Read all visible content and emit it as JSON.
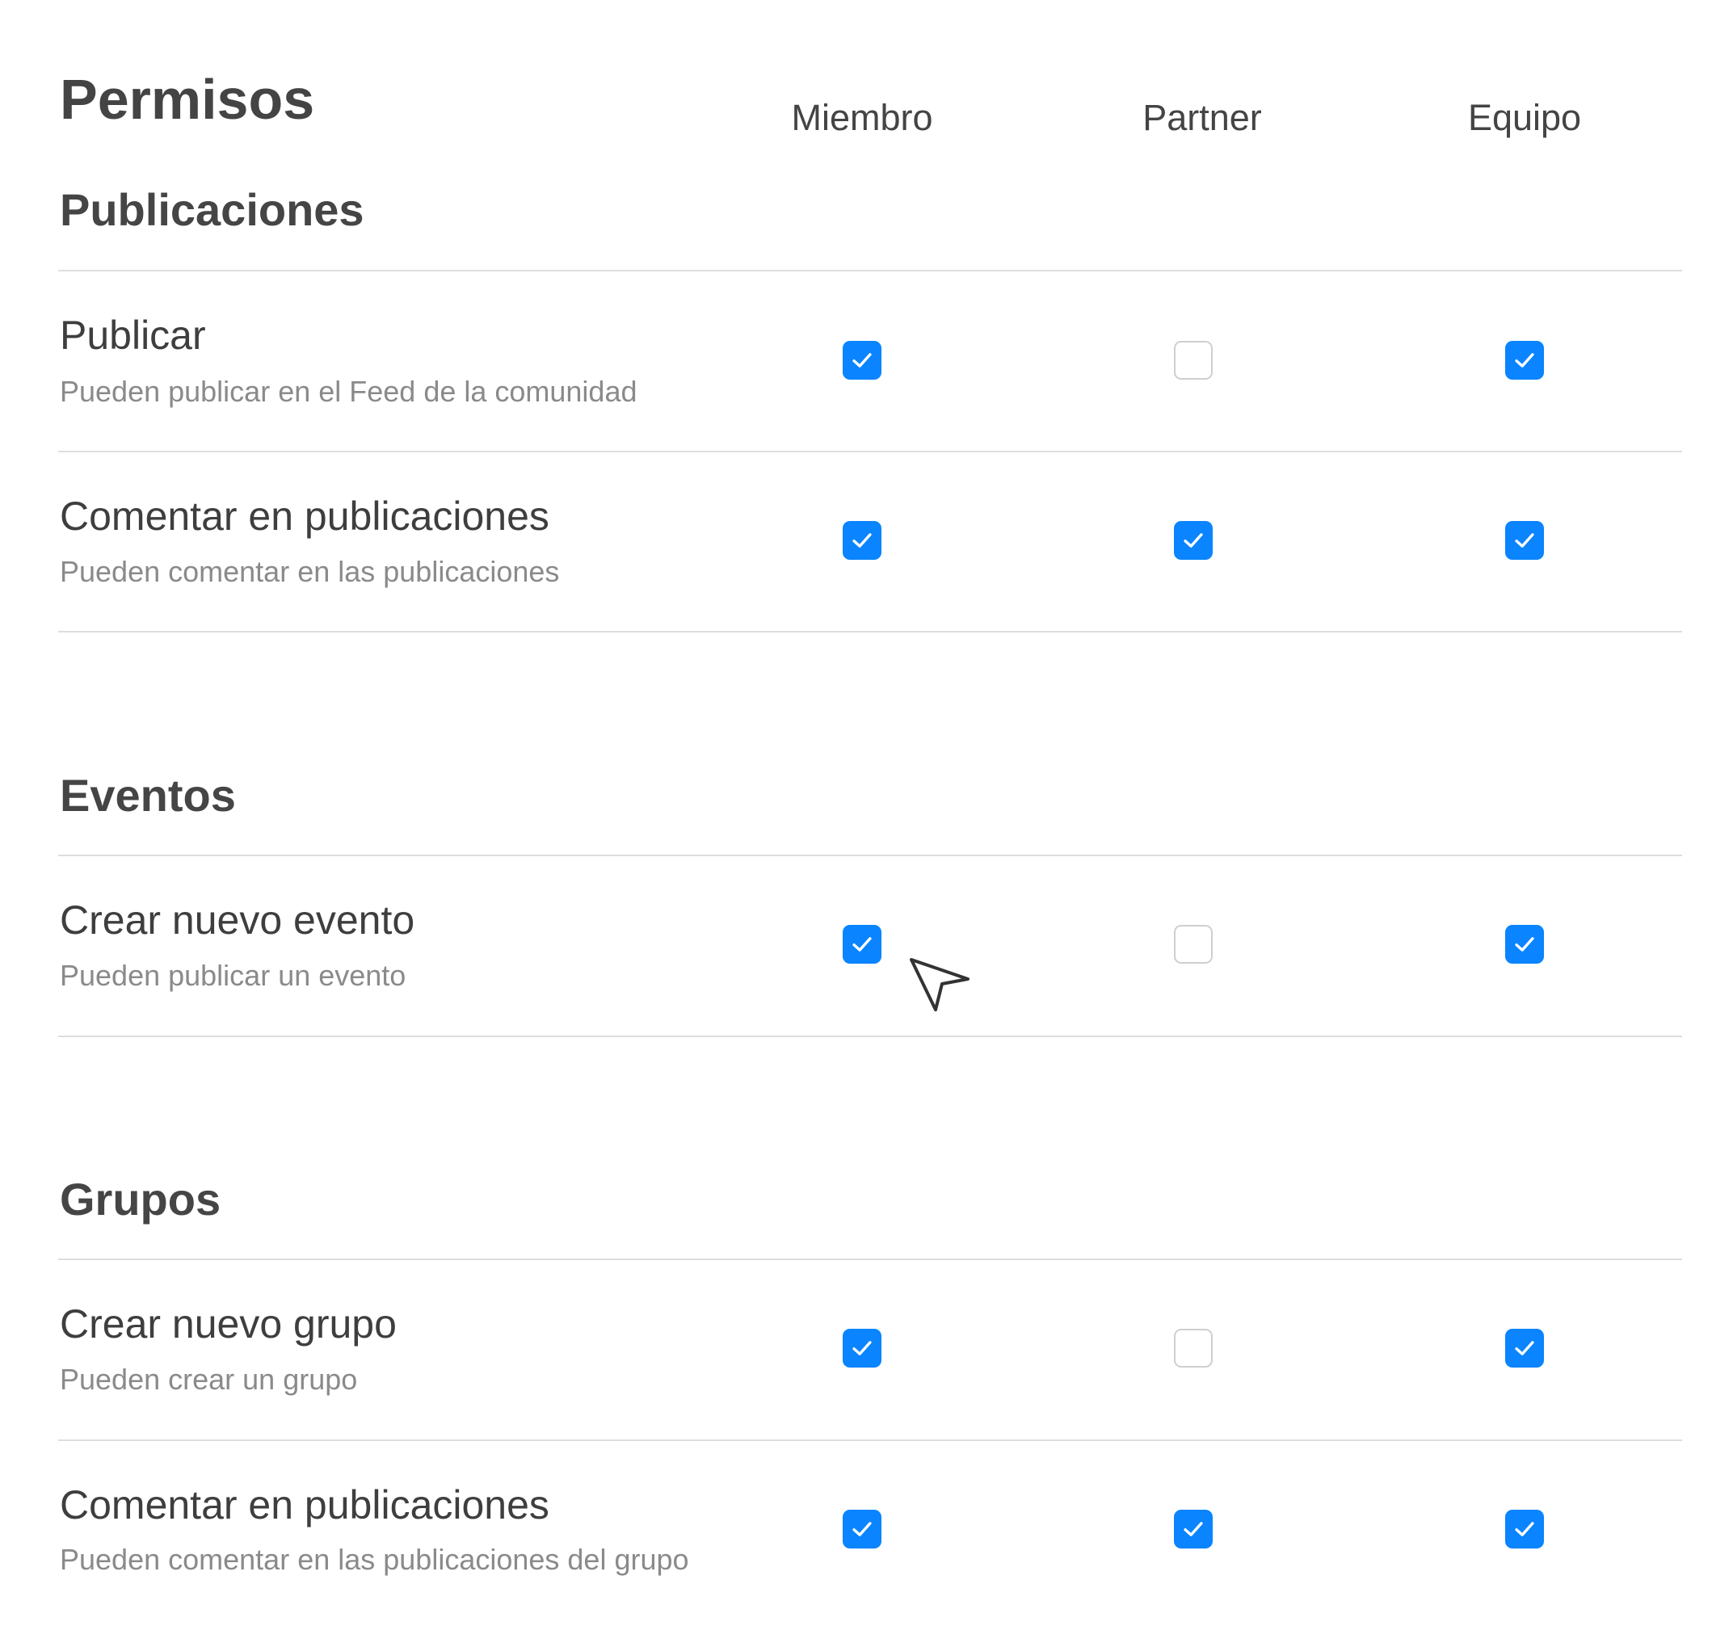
{
  "page": {
    "title": "Permisos"
  },
  "columns": [
    "Miembro",
    "Partner",
    "Equipo"
  ],
  "sections": [
    {
      "title": "Publicaciones",
      "rows": [
        {
          "title": "Publicar",
          "description": "Pueden publicar en el Feed de la comunidad",
          "checks": [
            true,
            false,
            true
          ]
        },
        {
          "title": "Comentar en publicaciones",
          "description": "Pueden comentar en las publicaciones",
          "checks": [
            true,
            true,
            true
          ]
        }
      ]
    },
    {
      "title": "Eventos",
      "rows": [
        {
          "title": "Crear nuevo evento",
          "description": "Pueden publicar un evento",
          "checks": [
            true,
            false,
            true
          ]
        }
      ]
    },
    {
      "title": "Grupos",
      "rows": [
        {
          "title": "Crear nuevo grupo",
          "description": "Pueden crear un grupo",
          "checks": [
            true,
            false,
            true
          ]
        },
        {
          "title": "Comentar en publicaciones",
          "description": "Pueden comentar en las publicaciones del grupo",
          "checks": [
            true,
            true,
            true
          ]
        }
      ]
    }
  ],
  "colors": {
    "accent": "#0a84ff",
    "unchecked_border": "#cfcfcf",
    "divider": "#dedede"
  },
  "icons": {
    "checkmark": "check-icon",
    "pointer": "cursor-arrow-icon"
  }
}
